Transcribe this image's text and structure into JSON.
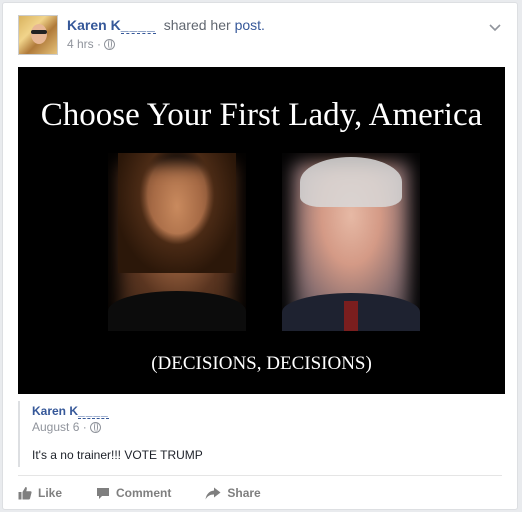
{
  "post": {
    "author_visible": "Karen K",
    "author_masked": "____",
    "action_text": "shared her",
    "post_link": "post.",
    "timestamp": "4 hrs ·"
  },
  "image": {
    "title": "Choose Your First Lady, America",
    "caption": "(DECISIONS, DECISIONS)"
  },
  "shared_post": {
    "author_visible": "Karen K",
    "author_masked": "____",
    "date": "August 6 ·",
    "text": "It's a no trainer!!! VOTE TRUMP"
  },
  "actions": {
    "like": "Like",
    "comment": "Comment",
    "share": "Share"
  },
  "colors": {
    "link": "#365899",
    "meta": "#90949c",
    "action": "#7f7f7f"
  }
}
